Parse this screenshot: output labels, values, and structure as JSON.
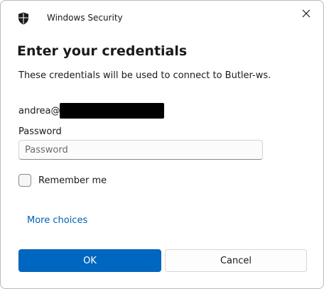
{
  "window": {
    "title": "Windows Security",
    "shield_icon": "shield-icon",
    "close_icon": "close-icon"
  },
  "dialog": {
    "heading": "Enter your credentials",
    "subtext": "These credentials will be used to connect to Butler-ws.",
    "username_prefix": "andrea@",
    "password_label": "Password",
    "password_placeholder": "Password",
    "password_value": "",
    "remember_label": "Remember me",
    "remember_checked": false,
    "more_choices": "More choices"
  },
  "buttons": {
    "ok": "OK",
    "cancel": "Cancel"
  },
  "colors": {
    "accent": "#0067c0",
    "link": "#005fb8",
    "redaction": "#000000"
  }
}
